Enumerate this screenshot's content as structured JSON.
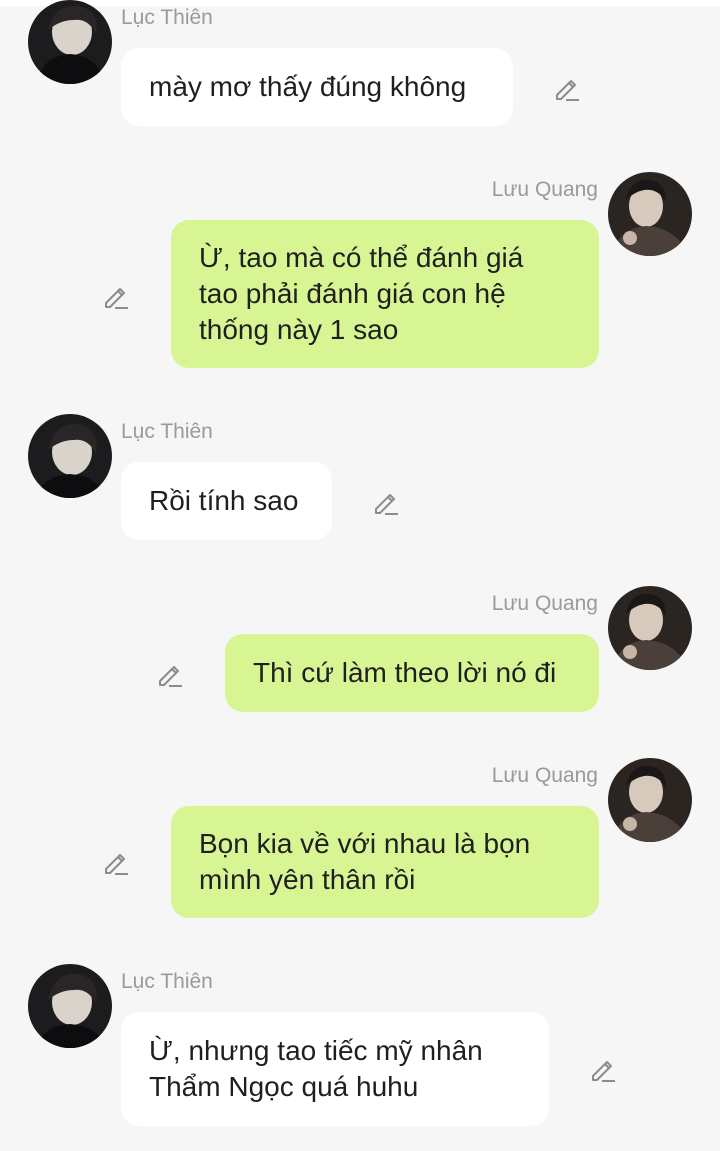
{
  "colors": {
    "background": "#f6f6f6",
    "incoming_bubble": "#ffffff",
    "outgoing_bubble": "#d8f593",
    "name_text": "#9a9a9a",
    "message_text": "#1f1f1f"
  },
  "messages": [
    {
      "sender": "Lục Thiên",
      "side": "left",
      "lines": [
        "mày mơ thấy đúng không"
      ],
      "avatar_icon": "avatar-luc-thien",
      "action_icon": "edit-pencil-icon"
    },
    {
      "sender": "Lưu Quang",
      "side": "right",
      "lines": [
        "Ừ, tao mà có thể đánh giá",
        "tao phải đánh giá con hệ",
        "thống này 1 sao"
      ],
      "avatar_icon": "avatar-luu-quang",
      "action_icon": "edit-pencil-icon"
    },
    {
      "sender": "Lục Thiên",
      "side": "left",
      "lines": [
        "Rồi tính sao"
      ],
      "avatar_icon": "avatar-luc-thien",
      "action_icon": "edit-pencil-icon"
    },
    {
      "sender": "Lưu Quang",
      "side": "right",
      "lines": [
        "Thì cứ làm theo lời nó đi"
      ],
      "avatar_icon": "avatar-luu-quang",
      "action_icon": "edit-pencil-icon"
    },
    {
      "sender": "Lưu Quang",
      "side": "right",
      "lines": [
        "Bọn kia về với nhau là bọn",
        "mình yên thân rồi"
      ],
      "avatar_icon": "avatar-luu-quang",
      "action_icon": "edit-pencil-icon"
    },
    {
      "sender": "Lục Thiên",
      "side": "left",
      "lines": [
        "Ừ, nhưng tao tiếc mỹ nhân",
        "Thẩm Ngọc quá huhu"
      ],
      "avatar_icon": "avatar-luc-thien",
      "action_icon": "edit-pencil-icon"
    }
  ]
}
